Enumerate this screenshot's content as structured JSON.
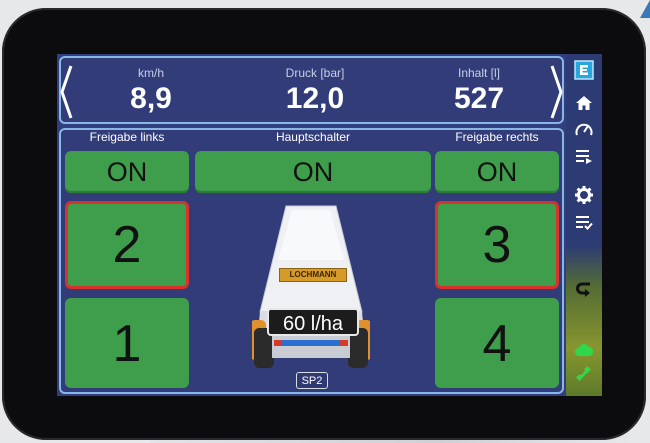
{
  "top_stats": [
    {
      "label": "km/h",
      "value": "8,9"
    },
    {
      "label": "Druck [bar]",
      "value": "12,0"
    },
    {
      "label": "Inhalt [l]",
      "value": "527"
    }
  ],
  "headers": {
    "left": "Freigabe links",
    "center": "Hauptschalter",
    "right": "Freigabe rechts"
  },
  "switches": {
    "left": "ON",
    "main": "ON",
    "right": "ON"
  },
  "sections": {
    "s2": "2",
    "s3": "3",
    "s1": "1",
    "s4": "4"
  },
  "sprayer": {
    "brand": "LOCHMANN",
    "rate": "60 l/ha",
    "mode": "SP2"
  },
  "sidebar_icons": [
    "e-logo-icon",
    "home-icon",
    "speedometer-icon",
    "list-arrow-icon",
    "gear-icon",
    "list-check-icon",
    "u-turn-icon",
    "cloud-icon",
    "satellite-icon"
  ],
  "colors": {
    "background": "#2f3f7f",
    "button": "#3f9e4b",
    "active_border": "#d8322d",
    "panel_border": "#8ab6e6"
  }
}
